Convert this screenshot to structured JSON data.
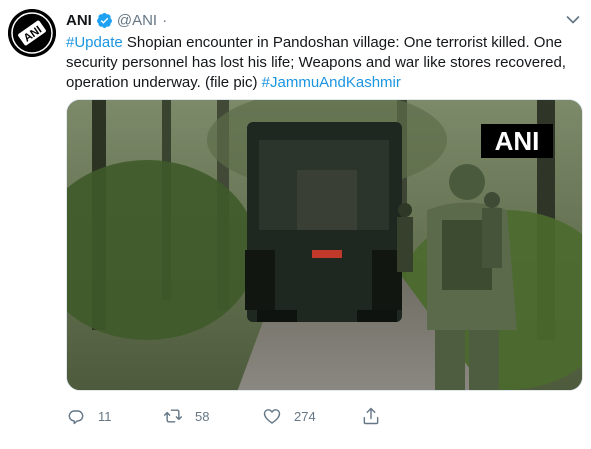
{
  "tweet": {
    "author_name": "ANI",
    "author_handle": "@ANI",
    "separator": "·",
    "avatar_text": "ANI",
    "text_lines": [
      [
        {
          "t": "#Update",
          "link": true
        },
        {
          "t": " Shopian encounter in Pandoshan village: One terrorist killed. One",
          "link": false
        }
      ],
      [
        {
          "t": "security personnel has lost his life; Weapons and war like stores recovered,",
          "link": false
        }
      ],
      [
        {
          "t": "operation underway. (file pic) ",
          "link": false
        },
        {
          "t": "#JammuAndKashmir",
          "link": true
        }
      ]
    ],
    "media": {
      "watermark": "ANI",
      "icon": "photo-of-armored-vehicle-and-soldiers"
    },
    "actions": {
      "reply_count": "11",
      "retweet_count": "58",
      "like_count": "274"
    }
  },
  "colors": {
    "link": "#1b95e0",
    "secondary": "#657786",
    "verified": "#1da1f2",
    "text": "#14171a"
  }
}
